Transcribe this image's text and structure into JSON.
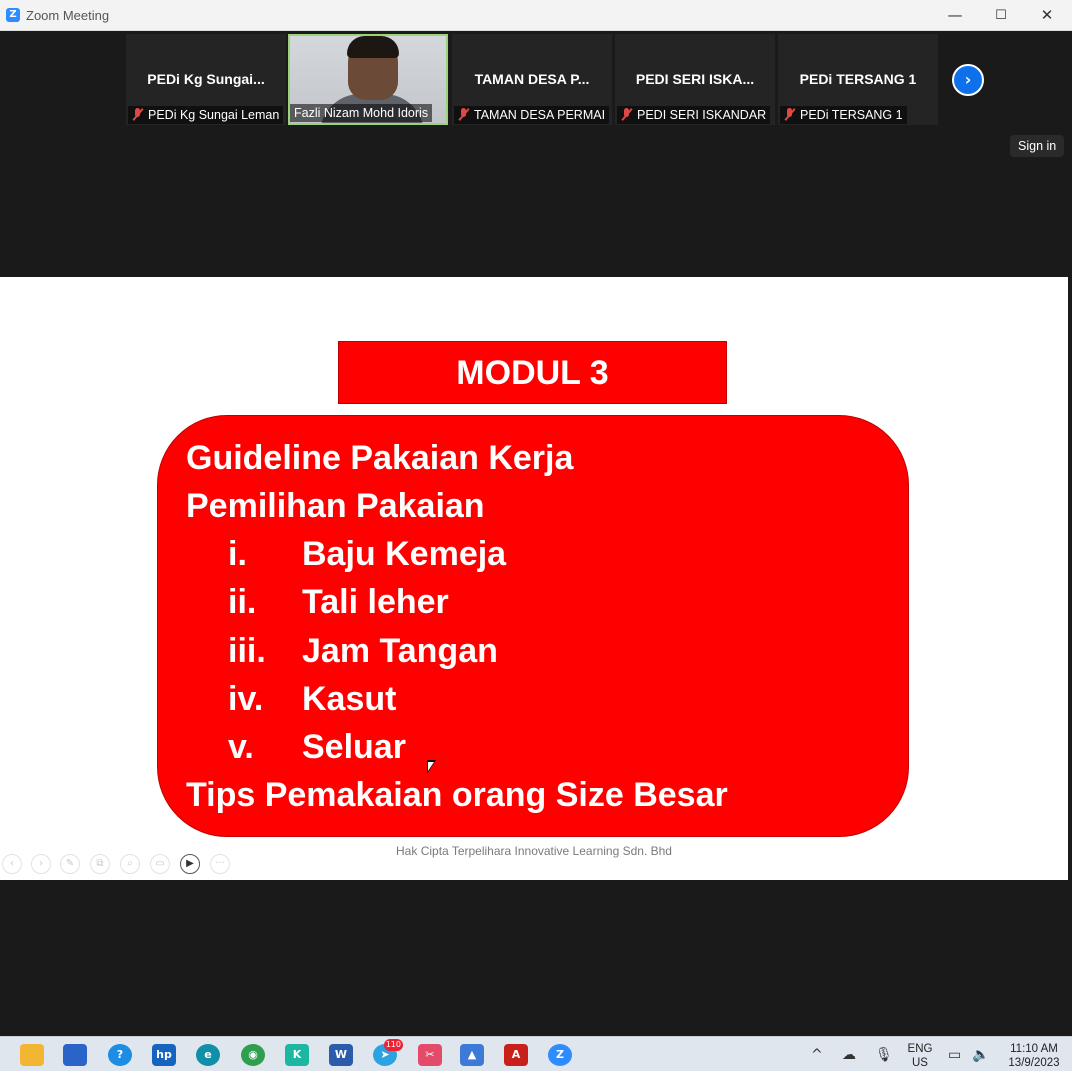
{
  "window": {
    "title": "Zoom Meeting",
    "minimize_icon": "—",
    "maximize_icon": "☐",
    "close_icon": "✕"
  },
  "participants": [
    {
      "display_title": "PEDi  Kg  Sungai...",
      "name": "PEDi Kg Sungai Leman",
      "muted": true
    },
    {
      "display_title": "",
      "name": "Fazli Nizam Mohd Idoris",
      "muted": false,
      "video": true
    },
    {
      "display_title": "TAMAN  DESA  P...",
      "name": "TAMAN DESA PERMAI",
      "muted": true
    },
    {
      "display_title": "PEDI  SERI  ISKA...",
      "name": "PEDI SERI ISKANDAR",
      "muted": true
    },
    {
      "display_title": "PEDi  TERSANG  1",
      "name": "PEDi TERSANG 1",
      "muted": true
    }
  ],
  "next_page_icon": "›",
  "sign_in_label": "Sign in",
  "slide": {
    "module_title": "MODUL 3",
    "heading1": "Guideline Pakaian Kerja",
    "heading2": "Pemilihan Pakaian",
    "items": [
      {
        "num": "i.",
        "text": "Baju Kemeja"
      },
      {
        "num": "ii.",
        "text": "Tali leher"
      },
      {
        "num": "iii.",
        "text": "Jam Tangan"
      },
      {
        "num": "iv.",
        "text": "Kasut"
      },
      {
        "num": "v.",
        "text": "Seluar"
      }
    ],
    "heading3": "Tips Pemakaian orang Size Besar",
    "footer": "Hak Cipta Terpelihara Innovative Learning Sdn. Bhd"
  },
  "slide_tools": [
    "‹",
    "›",
    "✎",
    "⧉",
    "⌕",
    "▭",
    "▶",
    "···"
  ],
  "taskbar": {
    "apps": [
      {
        "name": "file-explorer-icon",
        "color": "#f2b632",
        "glyph": ""
      },
      {
        "name": "store-icon",
        "color": "#2b64c8",
        "glyph": ""
      },
      {
        "name": "help-icon",
        "color": "#1c8de3",
        "glyph": "?"
      },
      {
        "name": "myhp-icon",
        "color": "#1664c0",
        "glyph": "hp"
      },
      {
        "name": "edge-icon",
        "color": "#0f8fa8",
        "glyph": "e"
      },
      {
        "name": "chrome-icon",
        "color": "#2f9e4f",
        "glyph": "◉"
      },
      {
        "name": "kahoot-icon",
        "color": "#1bb7a1",
        "glyph": "K"
      },
      {
        "name": "word-icon",
        "color": "#2a5cab",
        "glyph": "W"
      },
      {
        "name": "telegram-icon",
        "color": "#2aa3e0",
        "glyph": "➤",
        "badge": "110"
      },
      {
        "name": "snipping-tool-icon",
        "color": "#e44b6b",
        "glyph": "✂"
      },
      {
        "name": "photos-icon",
        "color": "#3d7ad8",
        "glyph": "▲"
      },
      {
        "name": "acrobat-icon",
        "color": "#c8211c",
        "glyph": "A"
      },
      {
        "name": "zoom-icon",
        "color": "#2d8cff",
        "glyph": "Z"
      }
    ],
    "tray": {
      "chevron": "^",
      "lang_top": "ENG",
      "lang_bottom": "US",
      "time": "11:10 AM",
      "date": "13/9/2023"
    }
  }
}
